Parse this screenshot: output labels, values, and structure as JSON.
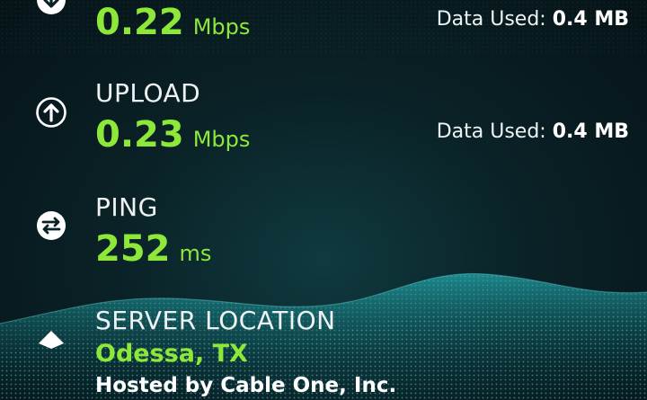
{
  "download": {
    "value": "0.22",
    "unit": "Mbps",
    "data_used_label": "Data Used:",
    "data_used_value": "0.4 MB",
    "icon": "download-arrow-icon"
  },
  "upload": {
    "label": "UPLOAD",
    "value": "0.23",
    "unit": "Mbps",
    "data_used_label": "Data Used:",
    "data_used_value": "0.4 MB",
    "icon": "upload-arrow-icon"
  },
  "ping": {
    "label": "PING",
    "value": "252",
    "unit": "ms",
    "icon": "ping-exchange-icon"
  },
  "server": {
    "label": "SERVER LOCATION",
    "city": "Odessa, TX",
    "host": "Hosted by Cable One, Inc.",
    "icon": "server-location-icon"
  },
  "colors": {
    "accent_green": "#8ee83a",
    "background": "#0a2227",
    "text": "#eef2f2"
  }
}
